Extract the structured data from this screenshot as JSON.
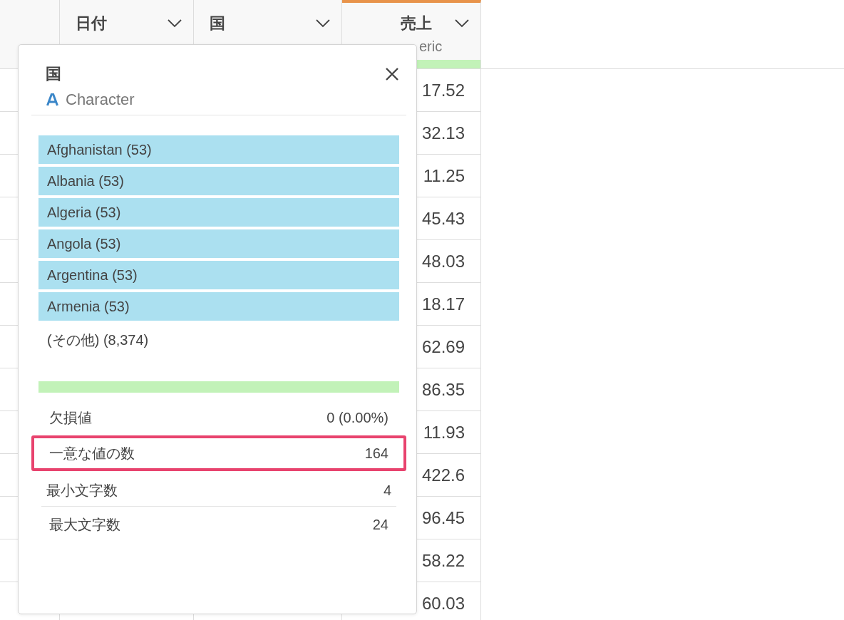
{
  "table": {
    "columns": [
      {
        "name": "日付",
        "selected": false
      },
      {
        "name": "国",
        "selected": false
      },
      {
        "name": "売上",
        "selected": true,
        "subtitle": "eric",
        "quality": {
          "level": 1
        }
      }
    ],
    "sales_values": [
      "17.52",
      "32.13",
      "11.25",
      "45.43",
      "48.03",
      "18.17",
      "62.69",
      "86.35",
      "11.93",
      "422.6",
      "96.45",
      "58.22",
      "60.03"
    ]
  },
  "popup": {
    "title": "国",
    "type": "Character",
    "top_values": [
      {
        "label": "Afghanistan (53)",
        "level": 1
      },
      {
        "label": "Albania (53)",
        "level": 1
      },
      {
        "label": "Algeria (53)",
        "level": 1
      },
      {
        "label": "Angola (53)",
        "level": 1
      },
      {
        "label": "Argentina (53)",
        "level": 1
      },
      {
        "label": "Armenia (53)",
        "level": 1
      }
    ],
    "other": "(その他) (8,374)",
    "valid_bar": {
      "level": 1
    },
    "stats": [
      {
        "label": "欠損値",
        "value": "0 (0.00%)",
        "highlighted": false
      },
      {
        "label": "一意な値の数",
        "value": "164",
        "highlighted": true
      },
      {
        "label": "最小文字数",
        "value": "4",
        "highlighted": false
      },
      {
        "label": "最大文字数",
        "value": "24",
        "highlighted": false
      }
    ]
  }
}
